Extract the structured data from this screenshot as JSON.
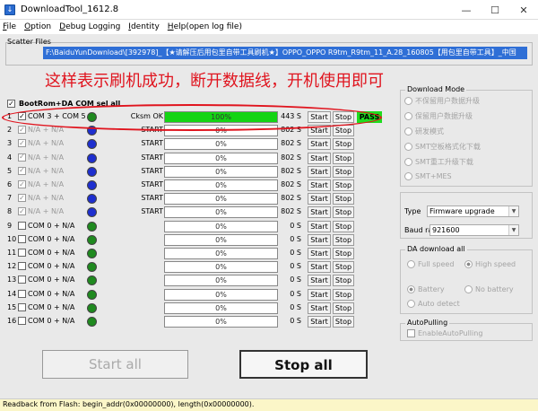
{
  "window": {
    "title": "DownloadTool_1612.8",
    "controls": [
      "—",
      "☐",
      "✕"
    ]
  },
  "menu": [
    "File",
    "Option",
    "Debug Logging",
    "Identity",
    "Help(open log file)"
  ],
  "scatter": {
    "label": "Scatter Files",
    "path": "F:\\BaiduYunDownload\\[392978]_【★请解压后用包里自带工具刷机★】OPPO_OPPO R9tm_R9tm_11_A.28_160805【用包里自带工具】_中国"
  },
  "caption": "这样表示刷机成功，断开数据线，开机使用即可",
  "bootrom": {
    "label": "BootRom+DA COM sel all",
    "checked": "✓"
  },
  "ports": [
    {
      "idx": "1",
      "check": "✓",
      "name": "COM 3 + COM 5",
      "led": "green",
      "status": "Cksm OK",
      "progress": 100,
      "pct": "100%",
      "speed": "443 S",
      "start": "Start",
      "stop": "Stop",
      "result": "PASS"
    },
    {
      "idx": "2",
      "check": "✓",
      "name": "N/A + N/A",
      "led": "blue",
      "status": "START",
      "progress": 0,
      "pct": "0%",
      "speed": "802 S",
      "start": "Start",
      "stop": "Stop",
      "result": "",
      "dim": true
    },
    {
      "idx": "3",
      "check": "✓",
      "name": "N/A + N/A",
      "led": "blue",
      "status": "START",
      "progress": 0,
      "pct": "0%",
      "speed": "802 S",
      "start": "Start",
      "stop": "Stop",
      "result": "",
      "dim": true
    },
    {
      "idx": "4",
      "check": "✓",
      "name": "N/A + N/A",
      "led": "blue",
      "status": "START",
      "progress": 0,
      "pct": "0%",
      "speed": "802 S",
      "start": "Start",
      "stop": "Stop",
      "result": "",
      "dim": true
    },
    {
      "idx": "5",
      "check": "✓",
      "name": "N/A + N/A",
      "led": "blue",
      "status": "START",
      "progress": 0,
      "pct": "0%",
      "speed": "802 S",
      "start": "Start",
      "stop": "Stop",
      "result": "",
      "dim": true
    },
    {
      "idx": "6",
      "check": "✓",
      "name": "N/A + N/A",
      "led": "blue",
      "status": "START",
      "progress": 0,
      "pct": "0%",
      "speed": "802 S",
      "start": "Start",
      "stop": "Stop",
      "result": "",
      "dim": true
    },
    {
      "idx": "7",
      "check": "✓",
      "name": "N/A + N/A",
      "led": "blue",
      "status": "START",
      "progress": 0,
      "pct": "0%",
      "speed": "802 S",
      "start": "Start",
      "stop": "Stop",
      "result": "",
      "dim": true
    },
    {
      "idx": "8",
      "check": "✓",
      "name": "N/A + N/A",
      "led": "blue",
      "status": "START",
      "progress": 0,
      "pct": "0%",
      "speed": "802 S",
      "start": "Start",
      "stop": "Stop",
      "result": "",
      "dim": true
    },
    {
      "idx": "9",
      "check": "",
      "name": "COM 0 + N/A",
      "led": "green",
      "status": "",
      "progress": 0,
      "pct": "0%",
      "speed": "0 S",
      "start": "Start",
      "stop": "Stop",
      "result": ""
    },
    {
      "idx": "10",
      "check": "",
      "name": "COM 0 + N/A",
      "led": "green",
      "status": "",
      "progress": 0,
      "pct": "0%",
      "speed": "0 S",
      "start": "Start",
      "stop": "Stop",
      "result": ""
    },
    {
      "idx": "11",
      "check": "",
      "name": "COM 0 + N/A",
      "led": "green",
      "status": "",
      "progress": 0,
      "pct": "0%",
      "speed": "0 S",
      "start": "Start",
      "stop": "Stop",
      "result": ""
    },
    {
      "idx": "12",
      "check": "",
      "name": "COM 0 + N/A",
      "led": "green",
      "status": "",
      "progress": 0,
      "pct": "0%",
      "speed": "0 S",
      "start": "Start",
      "stop": "Stop",
      "result": ""
    },
    {
      "idx": "13",
      "check": "",
      "name": "COM 0 + N/A",
      "led": "green",
      "status": "",
      "progress": 0,
      "pct": "0%",
      "speed": "0 S",
      "start": "Start",
      "stop": "Stop",
      "result": ""
    },
    {
      "idx": "14",
      "check": "",
      "name": "COM 0 + N/A",
      "led": "green",
      "status": "",
      "progress": 0,
      "pct": "0%",
      "speed": "0 S",
      "start": "Start",
      "stop": "Stop",
      "result": ""
    },
    {
      "idx": "15",
      "check": "",
      "name": "COM 0 + N/A",
      "led": "green",
      "status": "",
      "progress": 0,
      "pct": "0%",
      "speed": "0 S",
      "start": "Start",
      "stop": "Stop",
      "result": ""
    },
    {
      "idx": "16",
      "check": "",
      "name": "COM 0 + N/A",
      "led": "green",
      "status": "",
      "progress": 0,
      "pct": "0%",
      "speed": "0 S",
      "start": "Start",
      "stop": "Stop",
      "result": ""
    }
  ],
  "download_mode": {
    "title": "Download Mode",
    "options": [
      "不保留用户数据升级",
      "保留用户数据升级",
      "研发模式",
      "SMT空板格式化下载",
      "SMT重工升级下载",
      "SMT+MES"
    ]
  },
  "settings": {
    "type_label": "Type",
    "type_value": "Firmware upgrade",
    "baud_label": "Baud rate",
    "baud_value": "921600"
  },
  "da_download": {
    "title": "DA download all",
    "options": [
      "Full speed",
      "High speed",
      "Battery",
      "No battery",
      "Auto detect"
    ]
  },
  "autopulling": {
    "title": "AutoPulling",
    "option": "EnableAutoPulling"
  },
  "buttons": {
    "start_all": "Start all",
    "stop_all": "Stop all"
  },
  "status": {
    "text": "Readback from Flash:  begin_addr(0x00000000), length(0x00000000)."
  },
  "colors": {
    "pass": "#1fdc1f",
    "progress": "#14d414",
    "caption": "#e0141e",
    "highlight": "#2f6fd6"
  }
}
